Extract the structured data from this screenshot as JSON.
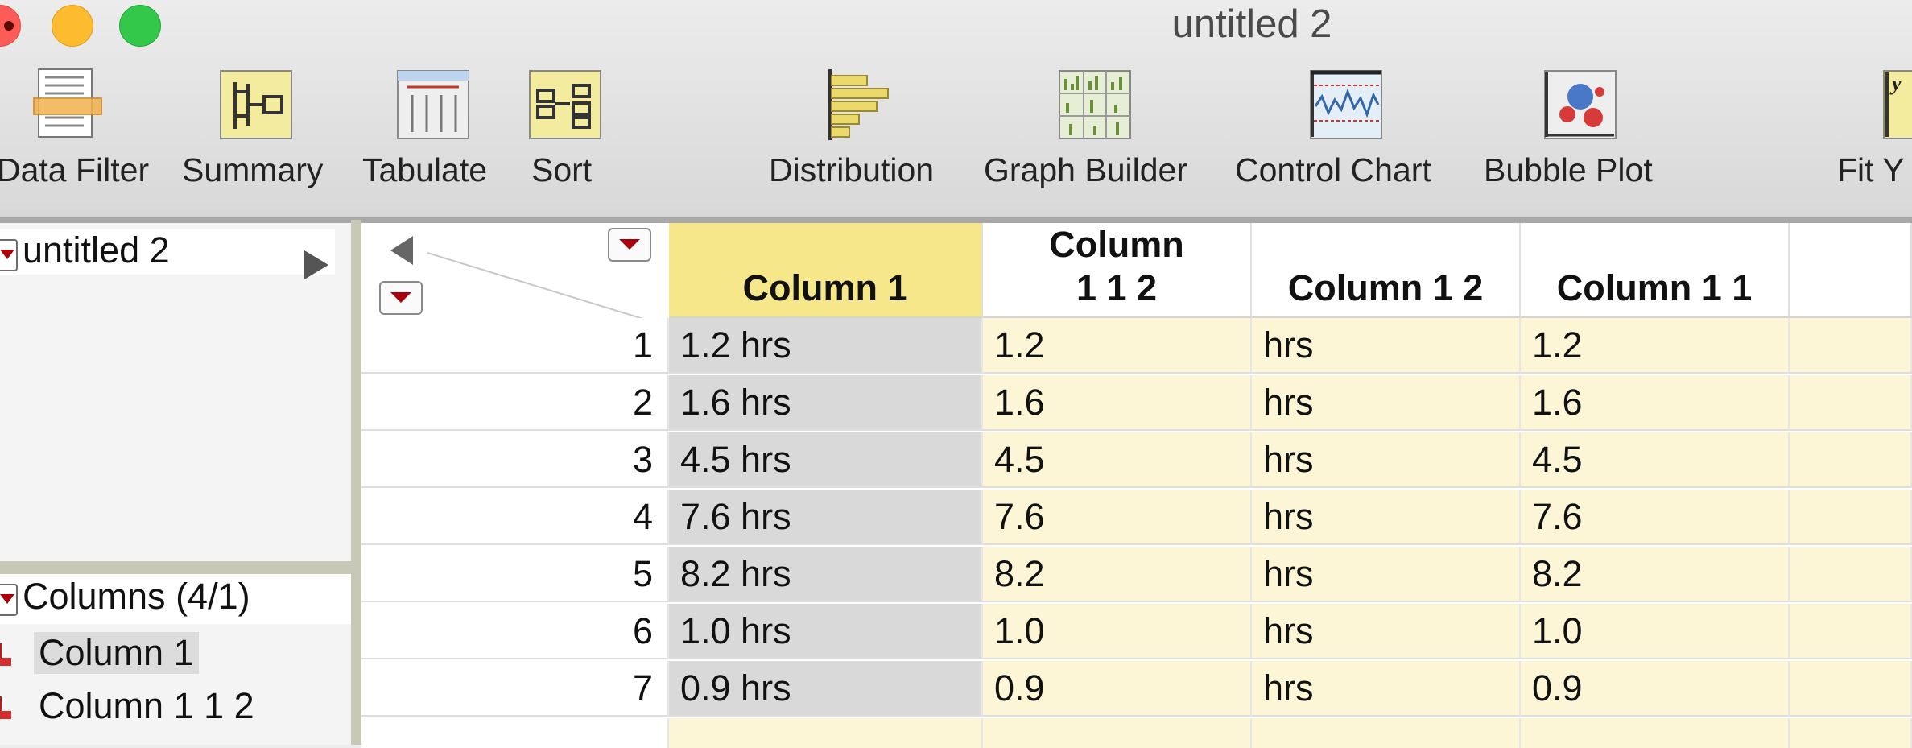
{
  "window": {
    "title": "untitled 2"
  },
  "toolbar": {
    "items": [
      {
        "label": "Data Filter",
        "icon": "data-filter-icon"
      },
      {
        "label": "Summary",
        "icon": "summary-icon"
      },
      {
        "label": "Tabulate",
        "icon": "tabulate-icon"
      },
      {
        "label": "Sort",
        "icon": "sort-icon"
      },
      {
        "label": "Distribution",
        "icon": "distribution-icon"
      },
      {
        "label": "Graph Builder",
        "icon": "graph-builder-icon"
      },
      {
        "label": "Control Chart",
        "icon": "control-chart-icon"
      },
      {
        "label": "Bubble Plot",
        "icon": "bubble-plot-icon"
      },
      {
        "label": "Fit Y",
        "icon": "fit-y-icon"
      }
    ]
  },
  "left_panel": {
    "table_name": "untitled 2",
    "columns_header": "Columns (4/1)",
    "columns": [
      {
        "name": "Column 1",
        "selected": true
      },
      {
        "name": "Column 1 1 2",
        "selected": false
      }
    ]
  },
  "grid": {
    "headers": [
      {
        "label": "Column 1",
        "selected": true
      },
      {
        "label": "Column 1 1 2",
        "selected": false
      },
      {
        "label": "Column 1 2",
        "selected": false
      },
      {
        "label": "Column 1 1",
        "selected": false
      }
    ],
    "rows": [
      {
        "n": "1",
        "cells": [
          "1.2 hrs",
          "1.2",
          "hrs",
          "1.2"
        ]
      },
      {
        "n": "2",
        "cells": [
          "1.6 hrs",
          "1.6",
          "hrs",
          "1.6"
        ]
      },
      {
        "n": "3",
        "cells": [
          "4.5 hrs",
          "4.5",
          "hrs",
          "4.5"
        ]
      },
      {
        "n": "4",
        "cells": [
          "7.6 hrs",
          "7.6",
          "hrs",
          "7.6"
        ]
      },
      {
        "n": "5",
        "cells": [
          "8.2 hrs",
          "8.2",
          "hrs",
          "8.2"
        ]
      },
      {
        "n": "6",
        "cells": [
          "1.0 hrs",
          "1.0",
          "hrs",
          "1.0"
        ]
      },
      {
        "n": "7",
        "cells": [
          "0.9 hrs",
          "0.9",
          "hrs",
          "0.9"
        ]
      }
    ]
  },
  "colors": {
    "selected_column_header": "#f6e88a",
    "selected_column_cells": "#d9d9d9",
    "cell_background": "#fdf6d6",
    "close": "#fc5b57",
    "minimize": "#fdbc2f",
    "maximize": "#34c84a"
  }
}
